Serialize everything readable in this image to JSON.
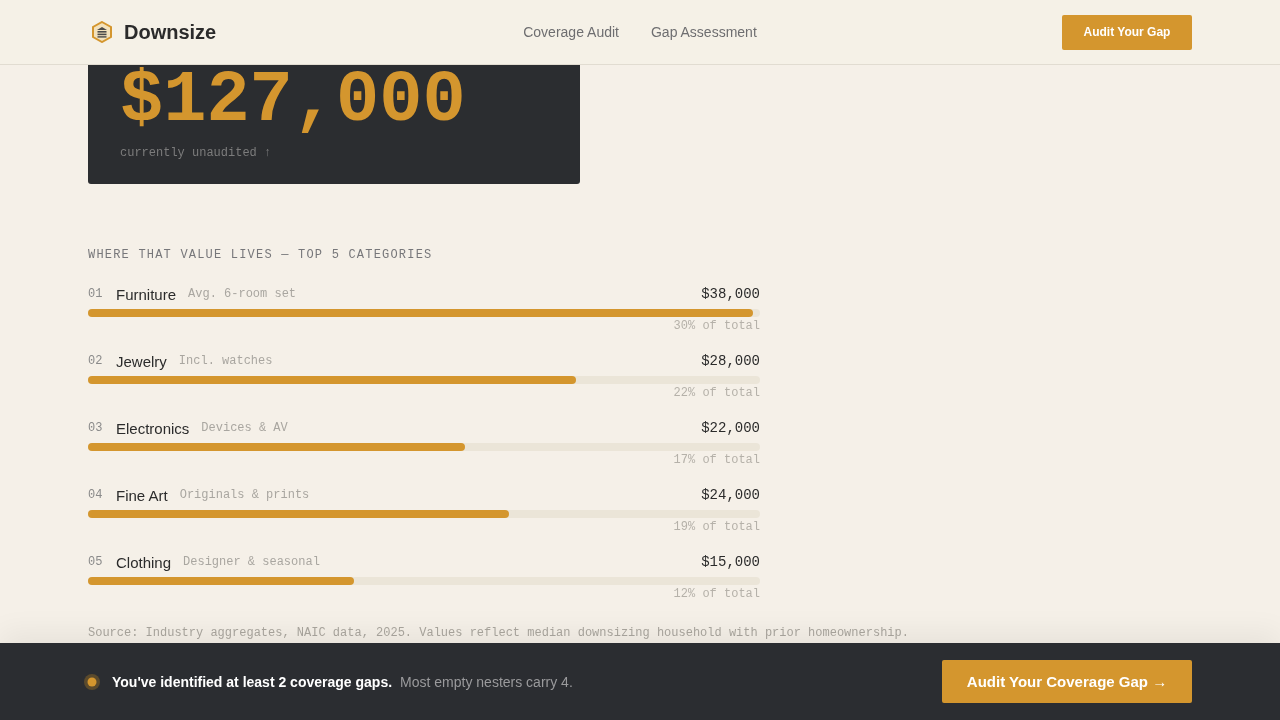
{
  "header": {
    "brand": "Downsize",
    "nav": [
      "Coverage Audit",
      "Gap Assessment"
    ],
    "button": "Audit Your Gap"
  },
  "hero": {
    "amount": "$127,000",
    "caption": "currently unaudited ↑"
  },
  "categories": {
    "heading": "WHERE THAT VALUE LIVES — TOP 5 CATEGORIES",
    "items": [
      {
        "index": "01",
        "name": "Furniture",
        "note": "Avg. 6-room set",
        "value": "$38,000",
        "level": 0.99,
        "share": "30% of total"
      },
      {
        "index": "02",
        "name": "Jewelry",
        "note": "Incl. watches",
        "value": "$28,000",
        "level": 0.726,
        "share": "22% of total"
      },
      {
        "index": "03",
        "name": "Electronics",
        "note": "Devices & AV",
        "value": "$22,000",
        "level": 0.561,
        "share": "17% of total"
      },
      {
        "index": "04",
        "name": "Fine Art",
        "note": "Originals & prints",
        "value": "$24,000",
        "level": 0.626,
        "share": "19% of total"
      },
      {
        "index": "05",
        "name": "Clothing",
        "note": "Designer & seasonal",
        "value": "$15,000",
        "level": 0.396,
        "share": "12% of total"
      }
    ]
  },
  "source": "Source: Industry aggregates, NAIC data, 2025. Values reflect median downsizing household with prior homeownership.",
  "banner": {
    "headline": "You've identified at least 2 coverage gaps.",
    "detail": "Most empty nesters carry 4.",
    "button": "Audit Your Coverage Gap →"
  }
}
